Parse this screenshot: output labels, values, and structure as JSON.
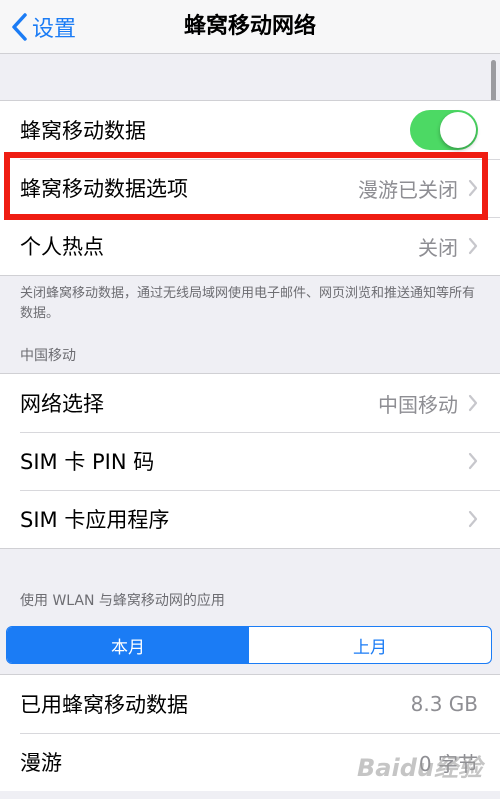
{
  "nav": {
    "back_label": "设置",
    "title": "蜂窝移动网络"
  },
  "group1": {
    "cellular_data_label": "蜂窝移动数据",
    "cellular_data_on": true,
    "options_label": "蜂窝移动数据选项",
    "options_value": "漫游已关闭",
    "hotspot_label": "个人热点",
    "hotspot_value": "关闭"
  },
  "footnote": "关闭蜂窝移动数据，通过无线局域网使用电子邮件、网页浏览和推送通知等所有数据。",
  "carrier_header": "中国移动",
  "group2": {
    "network_label": "网络选择",
    "network_value": "中国移动",
    "sim_pin_label": "SIM 卡 PIN 码",
    "sim_apps_label": "SIM 卡应用程序"
  },
  "usage_header": "使用 WLAN 与蜂窝移动网的应用",
  "segments": {
    "this_month": "本月",
    "last_month": "上月",
    "selected": "本月"
  },
  "group3": {
    "used_label": "已用蜂窝移动数据",
    "used_value": "8.3 GB",
    "roaming_label": "漫游",
    "roaming_value": "0 字节"
  },
  "watermark": "Baidu经验",
  "colors": {
    "accent": "#1b7cf5",
    "toggle_on": "#4cd964",
    "highlight": "#ef1d12"
  }
}
